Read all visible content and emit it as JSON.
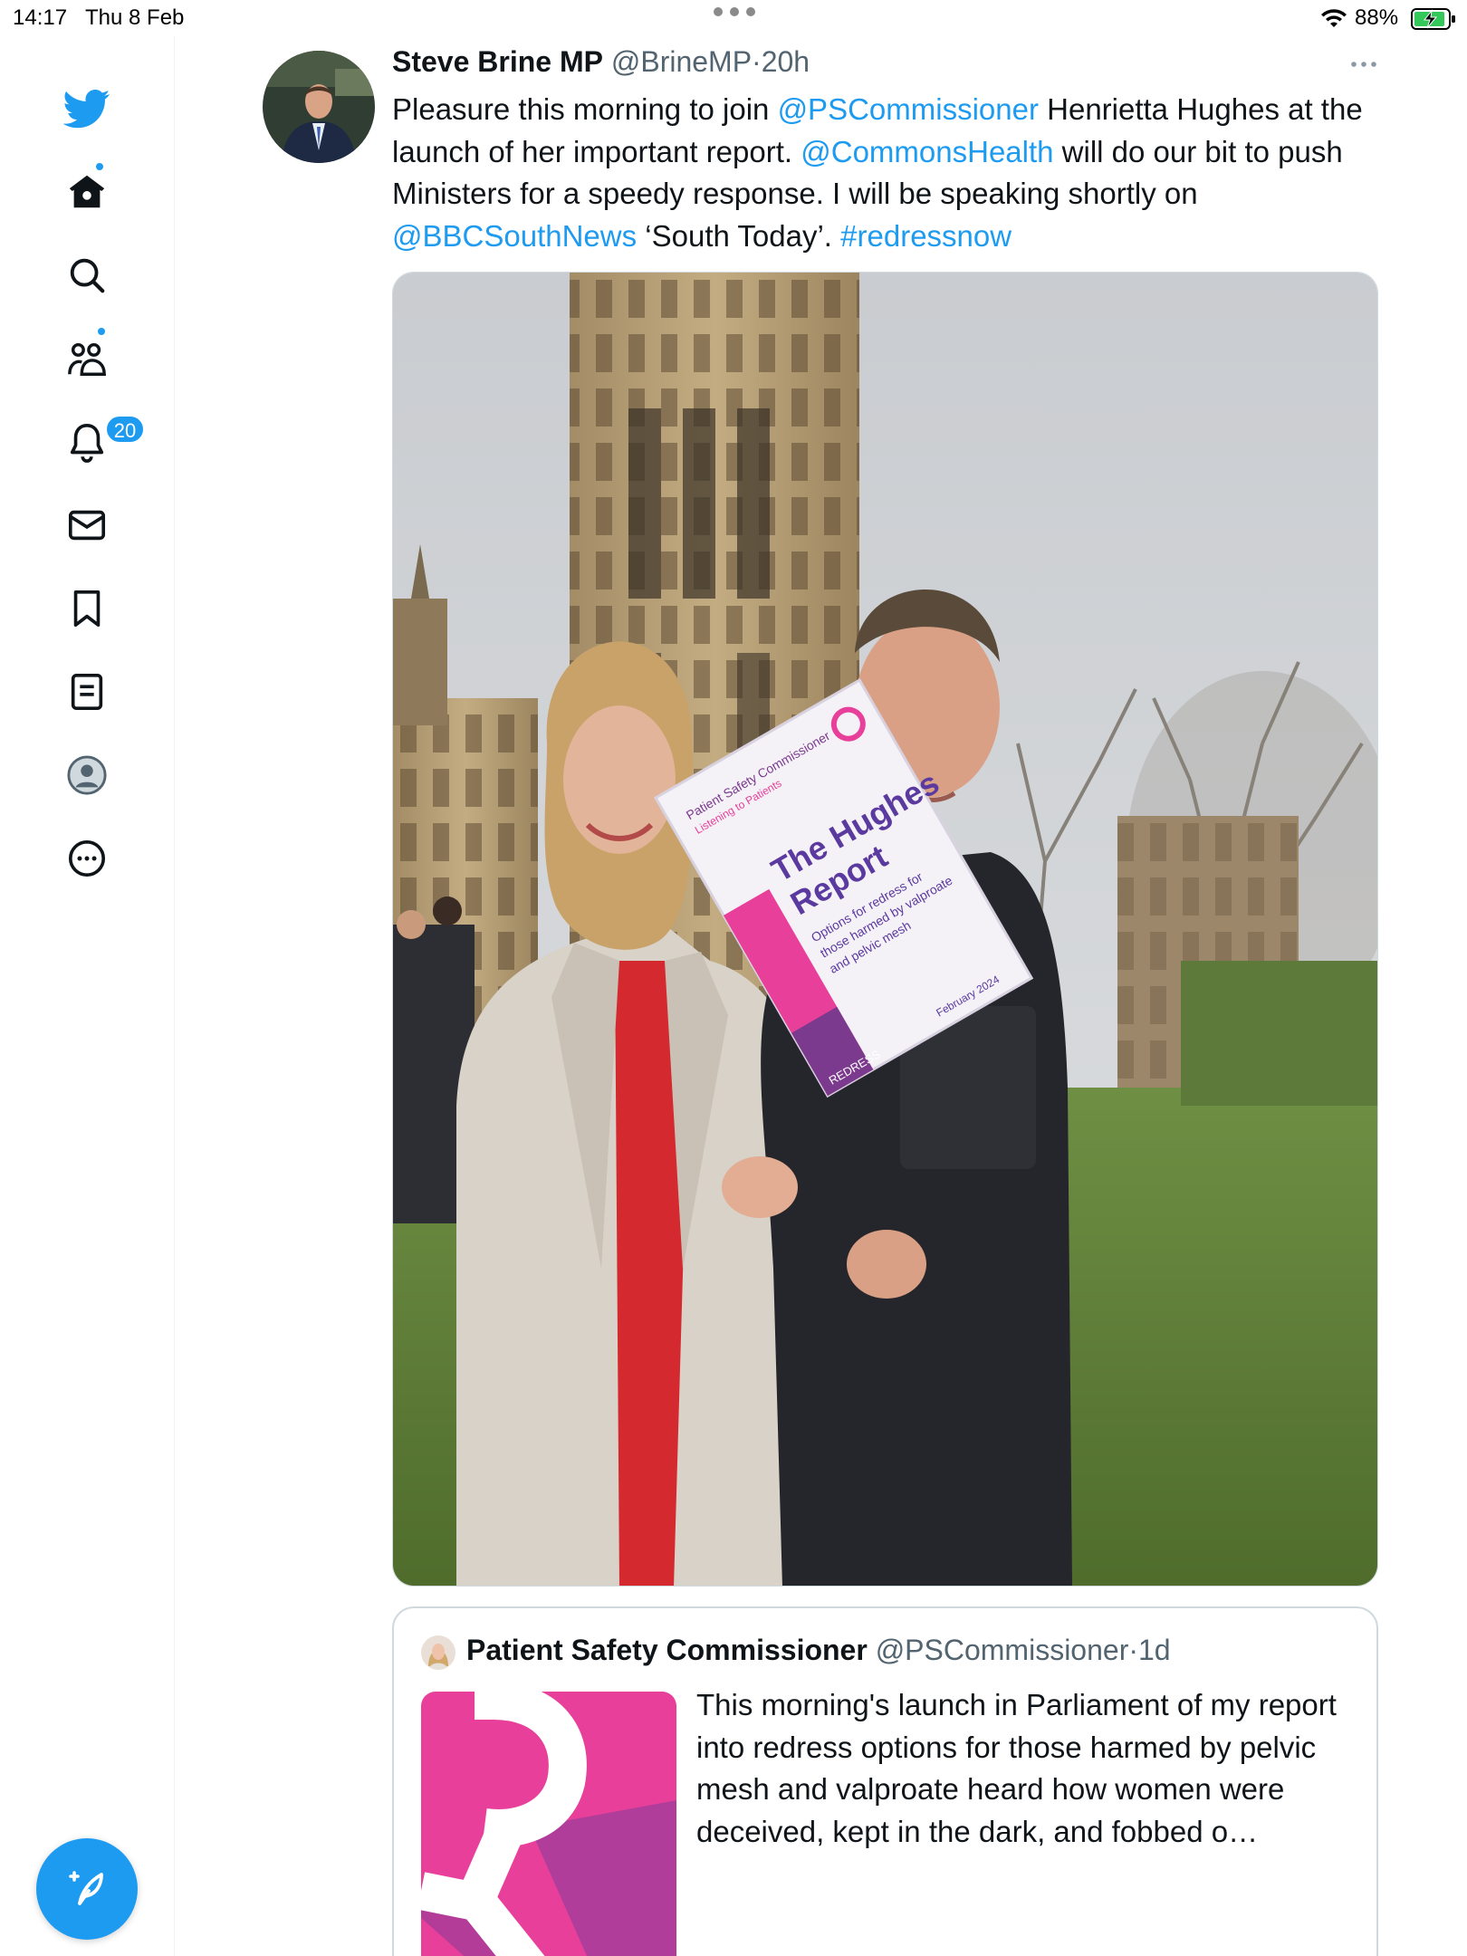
{
  "status_bar": {
    "time": "14:17",
    "date": "Thu 8 Feb",
    "battery": "88%"
  },
  "sidebar": {
    "items": [
      {
        "name": "twitter-logo",
        "icon": "bird-icon"
      },
      {
        "name": "home",
        "icon": "home-icon",
        "has_dot": true
      },
      {
        "name": "explore",
        "icon": "search-icon"
      },
      {
        "name": "communities",
        "icon": "communities-icon",
        "has_dot": true
      },
      {
        "name": "notifications",
        "icon": "bell-icon",
        "badge": "20"
      },
      {
        "name": "messages",
        "icon": "envelope-icon"
      },
      {
        "name": "bookmarks",
        "icon": "bookmark-icon"
      },
      {
        "name": "lists",
        "icon": "list-icon"
      },
      {
        "name": "profile",
        "icon": "profile-icon"
      },
      {
        "name": "more",
        "icon": "more-circle-icon"
      }
    ],
    "compose_icon": "compose-feather-icon"
  },
  "tweet": {
    "author_name": "Steve Brine MP",
    "author_handle": "@BrineMP",
    "separator": "·",
    "time": "20h",
    "text_parts": [
      {
        "text": "Pleasure this morning to join ",
        "link": false
      },
      {
        "text": "@PSCommissioner",
        "link": true
      },
      {
        "text": " Henrietta Hughes at the launch of her important report. ",
        "link": false
      },
      {
        "text": "@CommonsHealth",
        "link": true
      },
      {
        "text": " will do our bit to push Ministers for a speedy response. I will be speaking shortly on ",
        "link": false
      },
      {
        "text": "@BBCSouthNews",
        "link": true
      },
      {
        "text": " ‘South Today’. ",
        "link": false
      },
      {
        "text": "#redressnow",
        "link": true
      }
    ]
  },
  "photo": {
    "report_org": "Patient Safety Commissioner",
    "report_tagline": "Listening to Patients",
    "report_title_line1": "The Hughes",
    "report_title_line2": "Report",
    "report_subtitle_1": "Options for redress for",
    "report_subtitle_2": "those harmed by valproate",
    "report_subtitle_3": "and pelvic mesh",
    "report_corner": "REDRESS",
    "report_date": "February 2024"
  },
  "quoted_tweet": {
    "author_name": "Patient Safety Commissioner",
    "author_handle": "@PSCommissioner",
    "separator": "·",
    "time": "1d",
    "text": "This morning's launch in Parliament of my report into redress options for those harmed by pelvic mesh and valproate heard how women were deceived, kept in the dark, and fobbed o…"
  },
  "colors": {
    "accent": "#1d9bf0",
    "text": "#0f1419",
    "muted": "#536471",
    "border": "#cfd9de",
    "brand_pink": "#e8409a"
  }
}
